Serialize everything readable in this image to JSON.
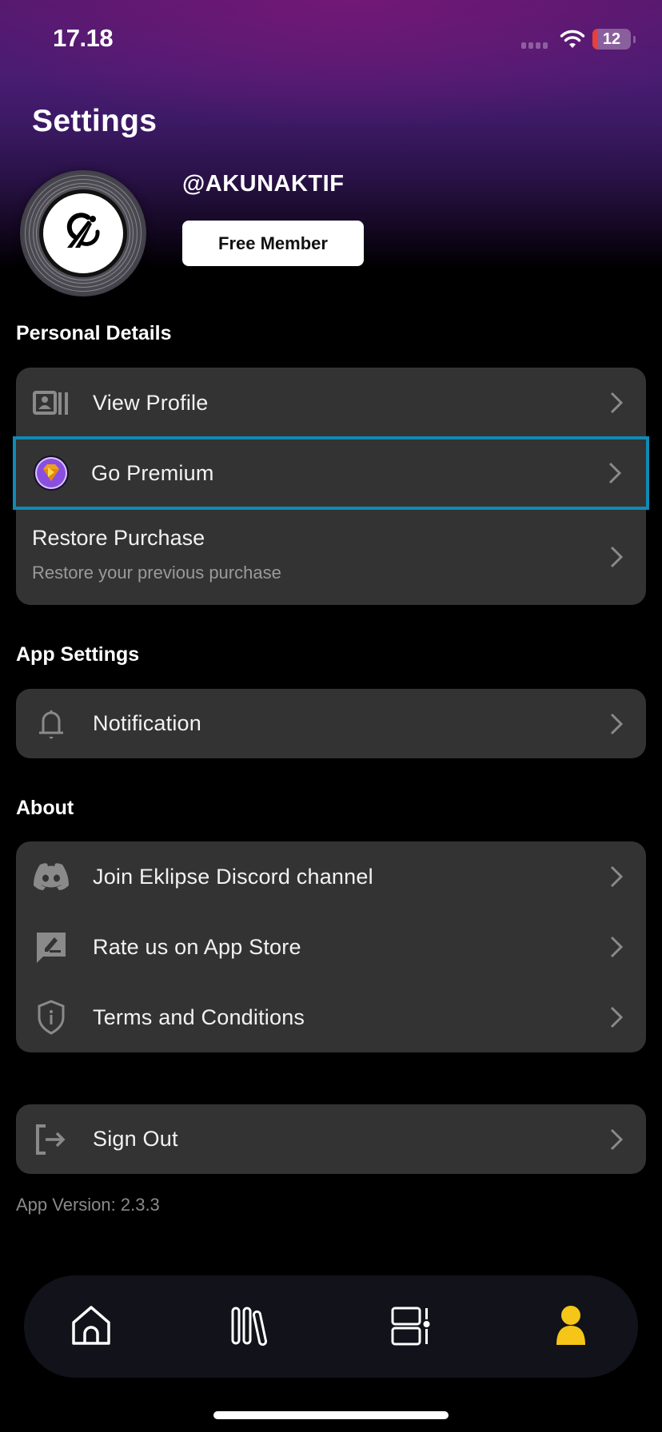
{
  "status_bar": {
    "time": "17.18",
    "battery_level": "12",
    "battery_percent": 12,
    "icons": [
      "signal-dots-icon",
      "wifi-icon",
      "battery-icon"
    ]
  },
  "page": {
    "title": "Settings"
  },
  "profile": {
    "username": "@AKUNAKTIF",
    "membership_label": "Free Member",
    "avatar_icon": "eklipse-logo-icon"
  },
  "sections": {
    "personal": {
      "title": "Personal Details",
      "items": [
        {
          "label": "View Profile",
          "icon": "profile-card-icon"
        },
        {
          "label": "Go Premium",
          "icon": "premium-gem-icon",
          "highlighted": true
        },
        {
          "label": "Restore Purchase",
          "sublabel": "Restore your previous purchase"
        }
      ]
    },
    "app_settings": {
      "title": "App Settings",
      "items": [
        {
          "label": "Notification",
          "icon": "bell-icon"
        }
      ]
    },
    "about": {
      "title": "About",
      "items": [
        {
          "label": "Join Eklipse Discord channel",
          "icon": "discord-icon"
        },
        {
          "label": "Rate us on App Store",
          "icon": "rate-feedback-icon"
        },
        {
          "label": "Terms and Conditions",
          "icon": "shield-info-icon"
        }
      ]
    },
    "account": {
      "items": [
        {
          "label": "Sign Out",
          "icon": "sign-out-icon"
        }
      ]
    }
  },
  "app_version": "App Version: 2.3.3",
  "bottom_nav": {
    "items": [
      {
        "name": "home",
        "icon": "home-icon",
        "active": false
      },
      {
        "name": "library",
        "icon": "library-icon",
        "active": false
      },
      {
        "name": "templates",
        "icon": "layout-icon",
        "active": false
      },
      {
        "name": "profile",
        "icon": "user-icon",
        "active": true
      }
    ],
    "active_color": "#f5c518"
  },
  "colors": {
    "accent_highlight": "#0e8bb5",
    "card_bg": "#333333",
    "active_nav": "#f5c518",
    "hero_purple": "#4a1c72"
  }
}
